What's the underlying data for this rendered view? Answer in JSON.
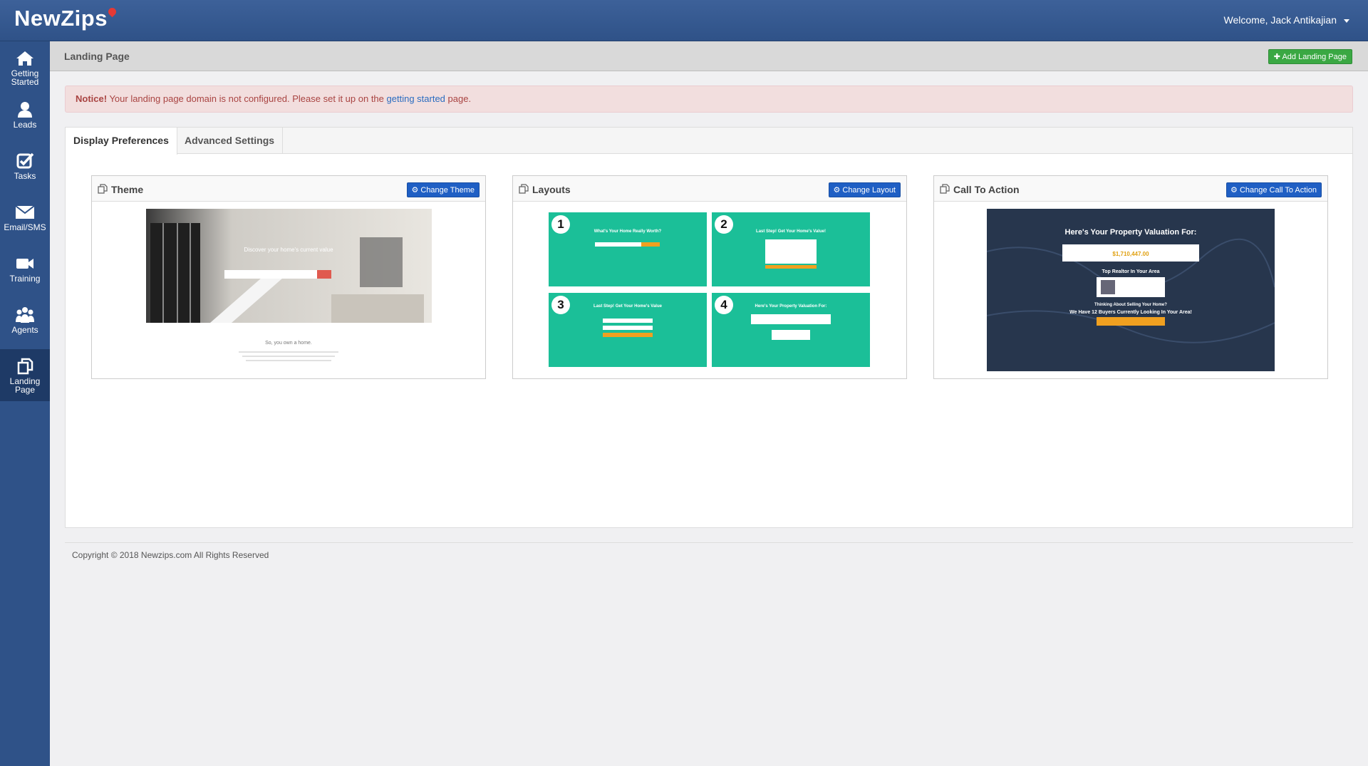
{
  "app": {
    "logo": "NewZips",
    "welcome": "Welcome, Jack Antikajian"
  },
  "sidebar": {
    "items": [
      {
        "label": "Getting Started",
        "icon": "home-icon"
      },
      {
        "label": "Leads",
        "icon": "user-icon"
      },
      {
        "label": "Tasks",
        "icon": "checkbox-icon"
      },
      {
        "label": "Email/SMS",
        "icon": "envelope-icon"
      },
      {
        "label": "Training",
        "icon": "video-camera-icon"
      },
      {
        "label": "Agents",
        "icon": "users-icon"
      },
      {
        "label": "Landing Page",
        "icon": "copy-icon",
        "active": true
      }
    ]
  },
  "header": {
    "title": "Landing Page",
    "add_button": "Add Landing Page"
  },
  "notice": {
    "strong": "Notice!",
    "text_before": " Your landing page domain is not configured. Please set it up on the ",
    "link": "getting started",
    "text_after": " page."
  },
  "tabs": [
    {
      "label": "Display Preferences",
      "active": true
    },
    {
      "label": "Advanced Settings",
      "active": false
    }
  ],
  "cards": {
    "theme": {
      "title": "Theme",
      "button": "Change Theme",
      "preview_heading": "Discover your home's current value",
      "preview_footer": "So, you own a home."
    },
    "layouts": {
      "title": "Layouts",
      "button": "Change Layout",
      "cells": [
        {
          "num": "1",
          "heading": "What's Your Home Really Worth?"
        },
        {
          "num": "2",
          "heading": "Last Step! Get Your Home's Value!"
        },
        {
          "num": "3",
          "heading": "Last Step! Get Your Home's Value"
        },
        {
          "num": "4",
          "heading": "Here's Your Property Valuation For:"
        }
      ]
    },
    "cta": {
      "title": "Call To Action",
      "button": "Change Call To Action",
      "heading": "Here's Your Property Valuation For:",
      "value": "$1,710,447.00",
      "realtor_heading": "Top Realtor In Your Area",
      "thinking": "Thinking About Selling Your Home?",
      "buyers": "We Have 12 Buyers Currently Looking In Your Area!"
    }
  },
  "footer": {
    "copyright": "Copyright © 2018 Newzips.com All Rights Reserved"
  },
  "colors": {
    "topbar": "#2f5288",
    "sidebar_active": "#1e3a66",
    "green_button": "#3aa843",
    "blue_button": "#1f5fc4",
    "layout_teal": "#1bbf98"
  }
}
